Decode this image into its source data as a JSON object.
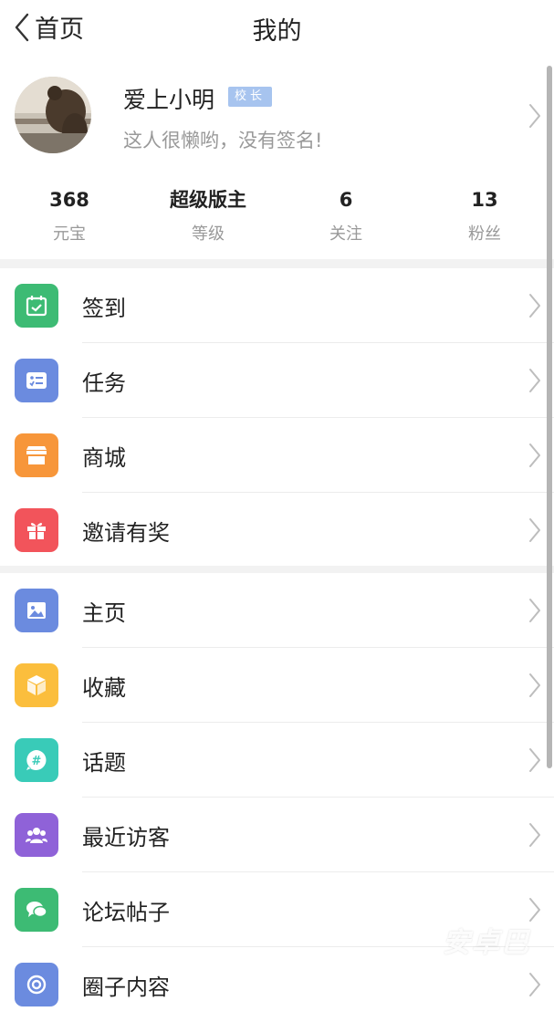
{
  "header": {
    "back_label": "首页",
    "title": "我的"
  },
  "profile": {
    "username": "爱上小明",
    "badge": "校长",
    "signature": "这人很懒哟，没有签名!"
  },
  "stats": [
    {
      "value": "368",
      "label": "元宝"
    },
    {
      "value": "超级版主",
      "label": "等级"
    },
    {
      "value": "6",
      "label": "关注"
    },
    {
      "value": "13",
      "label": "粉丝"
    }
  ],
  "menu_group_1": [
    {
      "label": "签到",
      "icon": "calendar-check-icon",
      "color": "#3dbb74"
    },
    {
      "label": "任务",
      "icon": "task-list-icon",
      "color": "#6b8bdf"
    },
    {
      "label": "商城",
      "icon": "store-icon",
      "color": "#f7963a"
    },
    {
      "label": "邀请有奖",
      "icon": "gift-icon",
      "color": "#f2545b"
    }
  ],
  "menu_group_2": [
    {
      "label": "主页",
      "icon": "image-icon",
      "color": "#6b8bdf"
    },
    {
      "label": "收藏",
      "icon": "box-icon",
      "color": "#fbbe3d"
    },
    {
      "label": "话题",
      "icon": "hashtag-bubble-icon",
      "color": "#39cbb8"
    },
    {
      "label": "最近访客",
      "icon": "users-icon",
      "color": "#8f62d8"
    },
    {
      "label": "论坛帖子",
      "icon": "chat-bubbles-icon",
      "color": "#3dbb74"
    },
    {
      "label": "圈子内容",
      "icon": "circle-content-icon",
      "color": "#6b8bdf"
    }
  ],
  "watermark": "安卓巴"
}
